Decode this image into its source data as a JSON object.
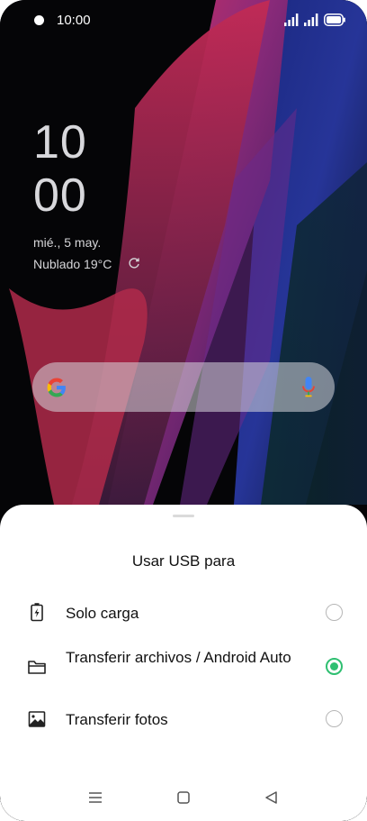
{
  "status_bar": {
    "time": "10:00",
    "icons": [
      "notification-dot-icon",
      "signal-icon",
      "signal-icon",
      "battery-icon"
    ]
  },
  "clock_widget": {
    "hours": "10",
    "minutes": "00",
    "date": "mié., 5 may.",
    "weather": "Nublado 19°C",
    "refresh_icon": "refresh-icon"
  },
  "search_bar": {
    "left_icon": "google-icon",
    "right_icon": "microphone-icon"
  },
  "usb_dialog": {
    "title": "Usar USB para",
    "options": [
      {
        "label": "Solo carga",
        "icon": "battery-charging-icon",
        "selected": false
      },
      {
        "label": "Transferir archivos / Android Auto",
        "icon": "folder-icon",
        "selected": true
      },
      {
        "label": "Transferir fotos",
        "icon": "photo-icon",
        "selected": false
      }
    ],
    "accent_color": "#2fbf71"
  },
  "nav_bar": {
    "icons": [
      "menu-icon",
      "home-icon",
      "back-icon"
    ]
  }
}
